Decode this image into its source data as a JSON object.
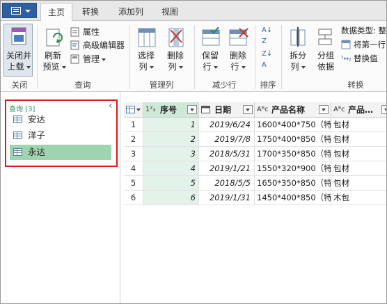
{
  "tabs": [
    {
      "label": "主页",
      "active": true
    },
    {
      "label": "转换",
      "active": false
    },
    {
      "label": "添加列",
      "active": false
    },
    {
      "label": "视图",
      "active": false
    }
  ],
  "ribbon": {
    "close_load": {
      "line1": "关闭并",
      "line2": "上载"
    },
    "refresh": {
      "line1": "刷新",
      "line2": "预览"
    },
    "properties": "属性",
    "advanced_editor": "高级编辑器",
    "manage": "管理",
    "choose_columns": {
      "line1": "选择",
      "line2": "列"
    },
    "remove_columns": {
      "line1": "删除",
      "line2": "列"
    },
    "keep_rows": {
      "line1": "保留",
      "line2": "行"
    },
    "remove_rows": {
      "line1": "删除",
      "line2": "行"
    },
    "split_column": {
      "line1": "拆分",
      "line2": "列"
    },
    "group_by": {
      "line1": "分组",
      "line2": "依据"
    },
    "data_type": "数据类型: 整",
    "use_first_row": "将第一行",
    "replace_values": "替换值",
    "groups": {
      "close": "关闭",
      "query": "查询",
      "manage_columns": "管理列",
      "reduce_rows": "减少行",
      "sort": "排序",
      "transform": "转换"
    }
  },
  "queries": {
    "header": "查询 [3]",
    "items": [
      {
        "label": "安达",
        "selected": false
      },
      {
        "label": "洋子",
        "selected": false
      },
      {
        "label": "永达",
        "selected": true
      }
    ]
  },
  "grid": {
    "type_seq": "1²₃",
    "type_text": "Aᴮc",
    "columns": [
      "序号",
      "日期",
      "产品名称",
      "产品"
    ],
    "rows": [
      {
        "n": "1",
        "seq": "1",
        "date": "2019/6/24",
        "name": "1600*400*750（特…",
        "pack": "包材"
      },
      {
        "n": "2",
        "seq": "2",
        "date": "2019/7/8",
        "name": "1750*400*850（特…",
        "pack": "包材"
      },
      {
        "n": "3",
        "seq": "3",
        "date": "2018/5/31",
        "name": "1700*350*850（特…",
        "pack": "包材"
      },
      {
        "n": "4",
        "seq": "4",
        "date": "2019/1/21",
        "name": "1550*320*900（特…",
        "pack": "包材"
      },
      {
        "n": "5",
        "seq": "5",
        "date": "2018/5/5",
        "name": "1650*350*850（特…",
        "pack": "包材"
      },
      {
        "n": "6",
        "seq": "6",
        "date": "2019/1/31",
        "name": "1450*400*850（特…",
        "pack": "木包"
      }
    ]
  },
  "colors": {
    "accent": "#217346",
    "highlight": "#9fd4b0",
    "annotation": "#e0191a"
  }
}
